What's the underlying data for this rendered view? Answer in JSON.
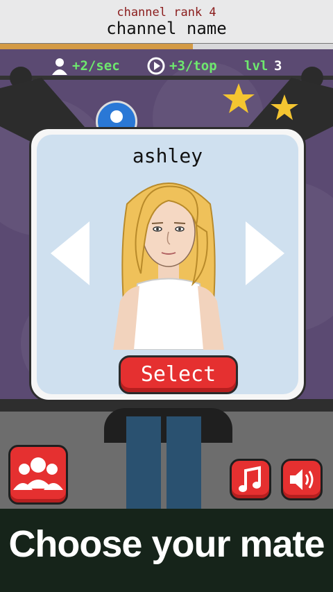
{
  "header": {
    "rank_label": "channel rank 4",
    "channel_name": "channel name",
    "progress_fraction": 0.58
  },
  "stats": {
    "followers_rate": "+2/sec",
    "views_rate": "+3/top",
    "level_label": "lvl",
    "level_value": "3",
    "followers_icon": "user-icon",
    "views_icon": "play-circle-icon"
  },
  "dialog": {
    "character_name": "ashley",
    "select_label": "Select",
    "prev_icon": "arrow-left-icon",
    "next_icon": "arrow-right-icon"
  },
  "buttons": {
    "friends_icon": "group-icon",
    "music_icon": "music-note-icon",
    "sound_icon": "speaker-icon"
  },
  "caption": "Choose your mate",
  "colors": {
    "accent_red": "#e53030",
    "stat_green": "#6ee86e",
    "caption_bg": "#16241a"
  }
}
